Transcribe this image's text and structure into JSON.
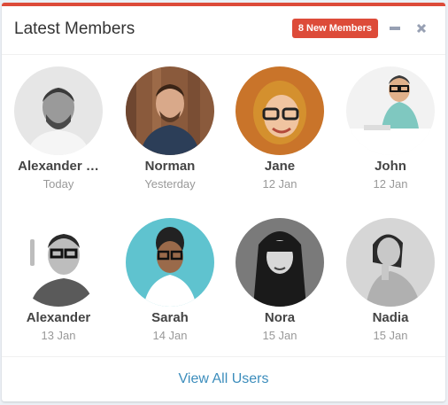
{
  "widget": {
    "title": "Latest Members",
    "badge": "8 New Members",
    "accent_color": "#dd4b39",
    "tools": [
      "minus-icon",
      "close-icon"
    ]
  },
  "members": [
    {
      "name": "Alexander …",
      "date": "Today"
    },
    {
      "name": "Norman",
      "date": "Yesterday"
    },
    {
      "name": "Jane",
      "date": "12 Jan"
    },
    {
      "name": "John",
      "date": "12 Jan"
    },
    {
      "name": "Alexander",
      "date": "13 Jan"
    },
    {
      "name": "Sarah",
      "date": "14 Jan"
    },
    {
      "name": "Nora",
      "date": "15 Jan"
    },
    {
      "name": "Nadia",
      "date": "15 Jan"
    }
  ],
  "footer": {
    "link_label": "View All Users",
    "link_color": "#3c8dbc"
  }
}
